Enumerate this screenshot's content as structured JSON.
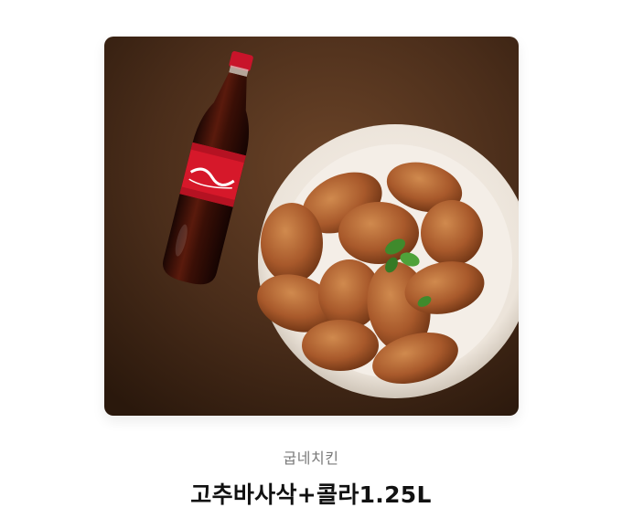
{
  "product": {
    "brand": "굽네치킨",
    "name": "고추바사삭+콜라1.25L",
    "image": {
      "depicts": [
        "cola-bottle",
        "roasted-chicken-plate",
        "mint-garnish"
      ],
      "bottle_label": "Coca-Cola"
    }
  },
  "colors": {
    "background": "#ffffff",
    "image_bg": "#4a2d1a",
    "plate": "#f2ece4",
    "chicken": "#a8592b",
    "cola_red": "#d6182a",
    "brand_text": "#7a7a7a",
    "title_text": "#111111"
  }
}
